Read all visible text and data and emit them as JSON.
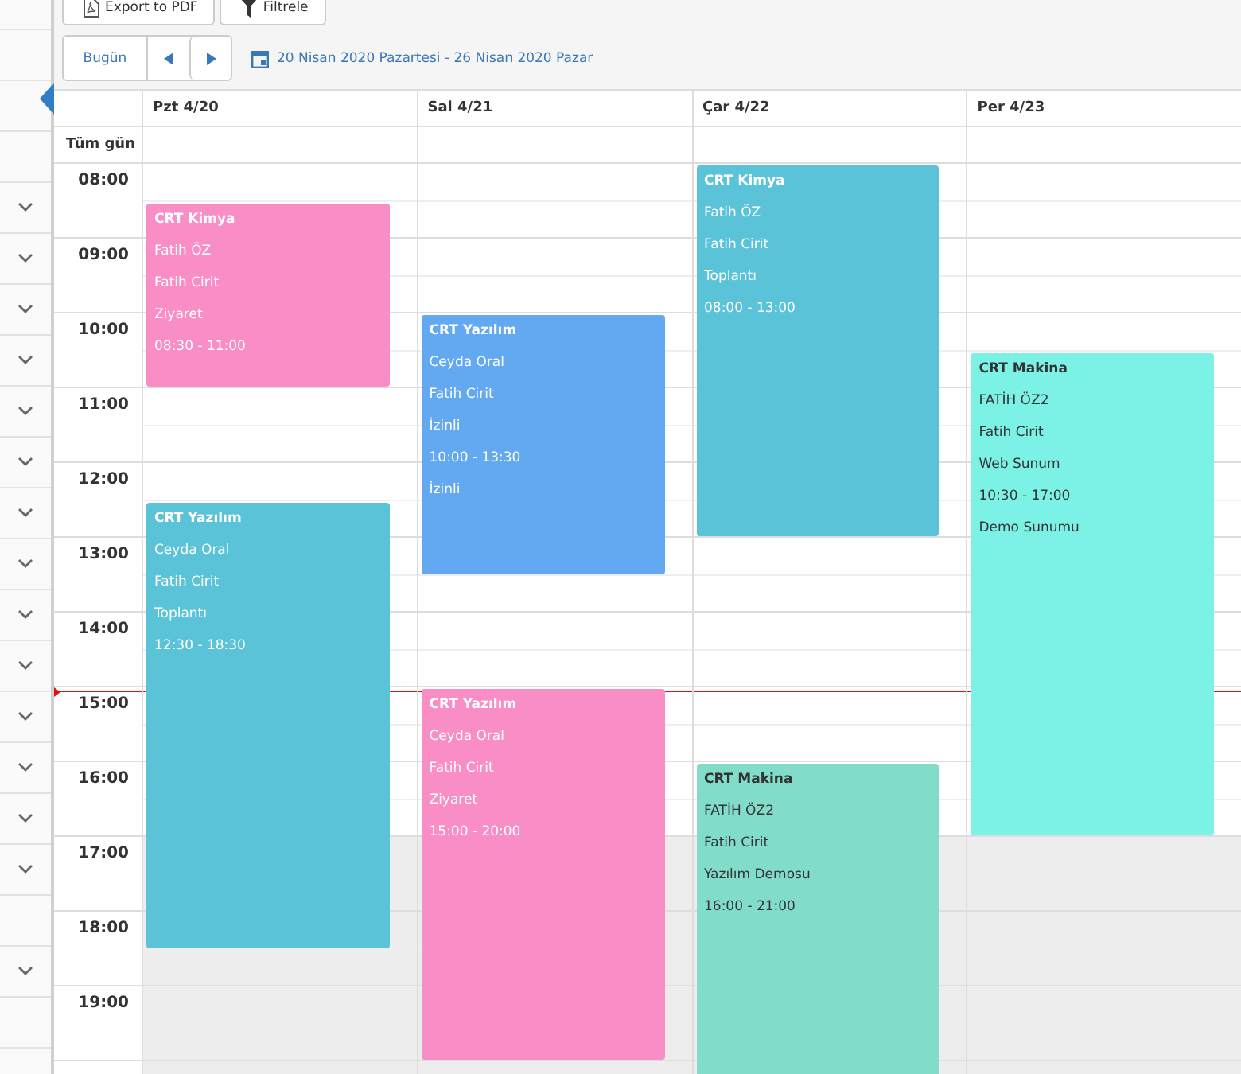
{
  "sidebar": {
    "rows": [
      {
        "expandable": false
      },
      {
        "expandable": false
      },
      {
        "expandable": false
      },
      {
        "expandable": false
      },
      {
        "expandable": true
      },
      {
        "expandable": true
      },
      {
        "expandable": true
      },
      {
        "expandable": true
      },
      {
        "expandable": true
      },
      {
        "expandable": true
      },
      {
        "expandable": true
      },
      {
        "expandable": true
      },
      {
        "expandable": true
      },
      {
        "expandable": true
      },
      {
        "expandable": true
      },
      {
        "expandable": true
      },
      {
        "expandable": true
      },
      {
        "expandable": true
      },
      {
        "expandable": false
      },
      {
        "expandable": true
      },
      {
        "expandable": false
      }
    ]
  },
  "toolbar": {
    "buttons": [
      {
        "label": "Export to PDF",
        "kind": "pdf"
      },
      {
        "label": "Filtrele",
        "kind": "filter"
      }
    ]
  },
  "nav": {
    "today": "Bugün",
    "date_range": "20 Nisan 2020 Pazartesi - 26 Nisan 2020 Pazar"
  },
  "calendar": {
    "all_day_label": "Tüm gün",
    "hours": [
      {
        "label": "08:00",
        "off_hours": false,
        "current": false
      },
      {
        "label": "09:00",
        "off_hours": false,
        "current": false
      },
      {
        "label": "10:00",
        "off_hours": false,
        "current": false
      },
      {
        "label": "11:00",
        "off_hours": false,
        "current": false
      },
      {
        "label": "12:00",
        "off_hours": false,
        "current": false
      },
      {
        "label": "13:00",
        "off_hours": false,
        "current": false
      },
      {
        "label": "14:00",
        "off_hours": false,
        "current": false
      },
      {
        "label": "15:00",
        "off_hours": false,
        "current": true
      },
      {
        "label": "16:00",
        "off_hours": false,
        "current": false
      },
      {
        "label": "17:00",
        "off_hours": true,
        "current": false
      },
      {
        "label": "18:00",
        "off_hours": true,
        "current": false
      },
      {
        "label": "19:00",
        "off_hours": true,
        "current": false
      }
    ],
    "days": [
      {
        "label": "Pzt 4/20",
        "events": [
          {
            "title": "CRT Kimya",
            "lines": [
              "Fatih ÖZ",
              "Fatih Cirit",
              "Ziyaret"
            ],
            "time": "08:30 - 11:00",
            "color": "#f98dc6"
          },
          {
            "title": "CRT Yazılım",
            "lines": [
              "Ceyda Oral",
              "Fatih Cirit",
              "Toplantı"
            ],
            "time": "12:30 - 18:30",
            "color": "#5bc3d8"
          }
        ]
      },
      {
        "label": "Sal 4/21",
        "events": [
          {
            "title": "CRT Yazılım",
            "lines": [
              "Ceyda Oral",
              "Fatih Cirit",
              "İzinli"
            ],
            "time": "10:00 - 13:30",
            "note": "İzinli",
            "color": "#62a9f2"
          },
          {
            "title": "CRT Yazılım",
            "lines": [
              "Ceyda Oral",
              "Fatih Cirit",
              "Ziyaret"
            ],
            "time": "15:00 - 20:00",
            "color": "#f98dc6"
          }
        ]
      },
      {
        "label": "Çar 4/22",
        "events": [
          {
            "title": "CRT Kimya",
            "lines": [
              "Fatih ÖZ",
              "Fatih Cirit",
              "Toplantı"
            ],
            "time": "08:00 - 13:00",
            "color": "#5bc3d8"
          },
          {
            "title": "CRT Makina",
            "lines": [
              "FATİH ÖZ2",
              "Fatih Cirit",
              "Yazılım Demosu"
            ],
            "time": "16:00 - 21:00",
            "color": "#82dcca"
          }
        ]
      },
      {
        "label": "Per 4/23",
        "events": [
          {
            "title": "CRT Makina",
            "lines": [
              "FATİH ÖZ2",
              "Fatih Cirit",
              "Web Sunum"
            ],
            "time": "10:30 - 17:00",
            "note": "Demo Sunumu",
            "color": "#7cf2e6"
          }
        ]
      }
    ]
  }
}
